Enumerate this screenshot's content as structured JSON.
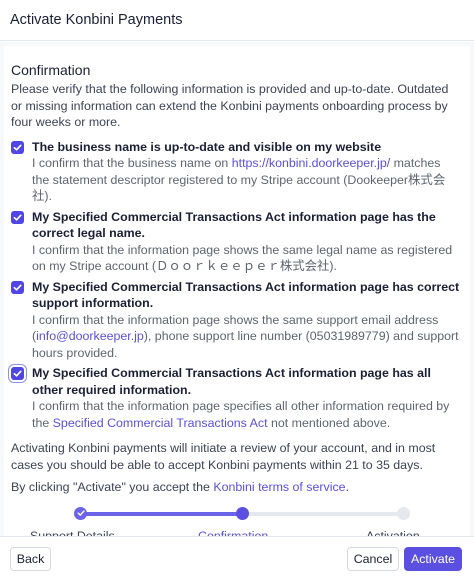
{
  "dialog": {
    "title": "Activate Konbini Payments"
  },
  "section": {
    "title": "Confirmation",
    "intro": "Please verify that the following information is provided and up-to-date. Outdated or missing information can extend the Konbini payments onboarding process by four weeks or more."
  },
  "items": [
    {
      "title": "The business name is up-to-date and visible on my website",
      "desc_pre": "I confirm that the business name on ",
      "desc_link": "https://konbini.doorkeeper.jp/",
      "desc_post": " matches the statement descriptor registered to my Stripe account (Dookeeper株式会社).",
      "checked": true
    },
    {
      "title": "My Specified Commercial Transactions Act information page has the correct legal name.",
      "desc": "I confirm that the information page shows the same legal name as registered on my Stripe account (Ｄｏｏｒｋｅｅｐｅｒ株式会社).",
      "checked": true
    },
    {
      "title": "My Specified Commercial Transactions Act information page has correct support information.",
      "desc_pre": "I confirm that the information page shows the same support email address (",
      "desc_link": "info@doorkeeper.jp",
      "desc_post": "), phone support line number (05031989779) and support hours provided.",
      "checked": true
    },
    {
      "title": "My Specified Commercial Transactions Act information page has all other required information.",
      "desc_pre": "I confirm that the information page specifies all other information required by the ",
      "desc_link": "Specified Commercial Transactions Act",
      "desc_post": " not mentioned above.",
      "checked": true
    }
  ],
  "activation_note": "Activating Konbini payments will initiate a review of your account, and in most cases you should be able to accept Konbini payments within 21 to 35 days.",
  "terms": {
    "pre": "By clicking \"Activate\" you accept the ",
    "link": "Konbini terms of service",
    "post": "."
  },
  "stepper": {
    "steps": [
      "Support Details",
      "Confirmation",
      "Activation"
    ],
    "current_step": 2,
    "progress_fraction": 0.5
  },
  "footer": {
    "back_label": "Back",
    "cancel_label": "Cancel",
    "activate_label": "Activate"
  },
  "colors": {
    "accent": "#5a4fe0",
    "track": "#e6e8ee",
    "text": "#3c4257"
  },
  "icons": {
    "checkbox": "check-icon"
  }
}
